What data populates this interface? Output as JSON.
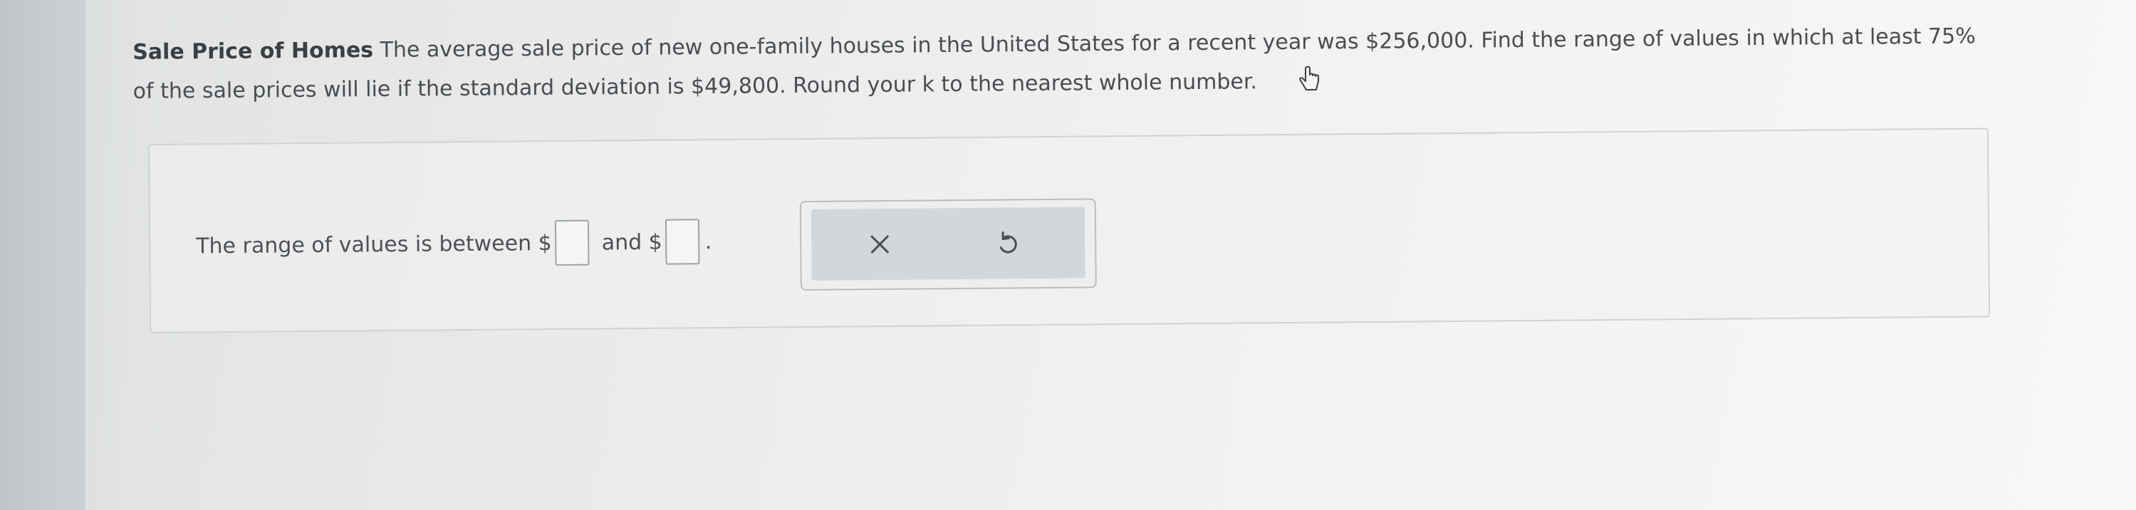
{
  "question": {
    "title": "Sale Price of Homes",
    "body": "The average sale price of new one-family houses in the United States for a recent year was $256,000. Find the range of values in which at least 75% of the sale prices will lie if the standard deviation is $49,800. Round your k to the nearest whole number."
  },
  "answer": {
    "prefix": "The range of values is between $",
    "middle": "and $",
    "suffix": ".",
    "lower_value": "",
    "upper_value": ""
  },
  "actions": {
    "clear_icon": "close-icon",
    "undo_icon": "undo-icon"
  }
}
